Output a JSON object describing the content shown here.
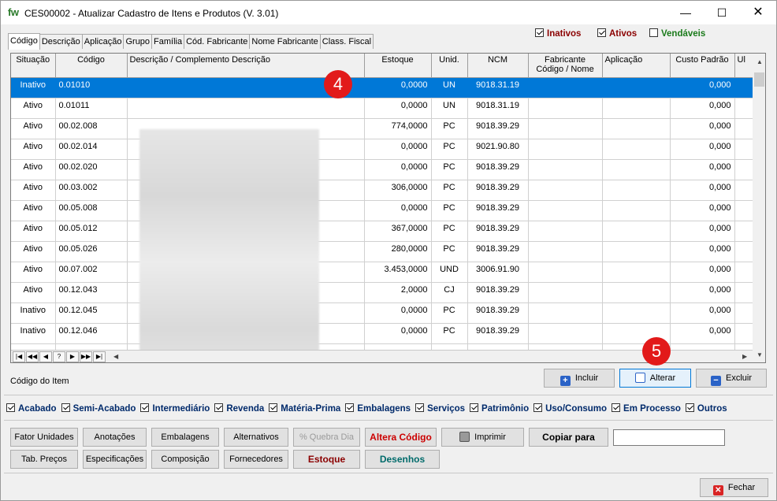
{
  "window": {
    "icon_text": "fw",
    "title": "CES00002 - Atualizar Cadastro de Itens e Produtos  (V. 3.01)",
    "min_glyph": "—",
    "max_glyph": "☐",
    "close_glyph": "✕"
  },
  "tabs": [
    "Código",
    "Descrição",
    "Aplicação",
    "Grupo",
    "Família",
    "Cód. Fabricante",
    "Nome Fabricante",
    "Class. Fiscal"
  ],
  "filters_top": [
    {
      "label": "Inativos",
      "checked": true,
      "color": "#8b0000"
    },
    {
      "label": "Ativos",
      "checked": true,
      "color": "#8b0000"
    },
    {
      "label": "Vendáveis",
      "checked": false,
      "color": "#1a7a1a"
    }
  ],
  "grid": {
    "columns": [
      "Situação",
      "Código",
      "Descrição / Complemento Descrição",
      "Estoque",
      "Unid.",
      "NCM",
      "Fabricante Código / Nome",
      "Aplicação",
      "Custo Padrão",
      "Ul"
    ],
    "rows": [
      [
        "Inativo",
        "0.01010",
        "0,0000",
        "UN",
        "9018.31.19",
        "0,000"
      ],
      [
        "Ativo",
        "0.01011",
        "0,0000",
        "UN",
        "9018.31.19",
        "0,000"
      ],
      [
        "Ativo",
        "00.02.008",
        "774,0000",
        "PC",
        "9018.39.29",
        "0,000"
      ],
      [
        "Ativo",
        "00.02.014",
        "0,0000",
        "PC",
        "9021.90.80",
        "0,000"
      ],
      [
        "Ativo",
        "00.02.020",
        "0,0000",
        "PC",
        "9018.39.29",
        "0,000"
      ],
      [
        "Ativo",
        "00.03.002",
        "306,0000",
        "PC",
        "9018.39.29",
        "0,000"
      ],
      [
        "Ativo",
        "00.05.008",
        "0,0000",
        "PC",
        "9018.39.29",
        "0,000"
      ],
      [
        "Ativo",
        "00.05.012",
        "367,0000",
        "PC",
        "9018.39.29",
        "0,000"
      ],
      [
        "Ativo",
        "00.05.026",
        "280,0000",
        "PC",
        "9018.39.29",
        "0,000"
      ],
      [
        "Ativo",
        "00.07.002",
        "3.453,0000",
        "UND",
        "3006.91.90",
        "0,000"
      ],
      [
        "Ativo",
        "00.12.043",
        "2,0000",
        "CJ",
        "9018.39.29",
        "0,000"
      ],
      [
        "Inativo",
        "00.12.045",
        "0,0000",
        "PC",
        "9018.39.29",
        "0,000"
      ],
      [
        "Inativo",
        "00.12.046",
        "0,0000",
        "PC",
        "9018.39.29",
        "0,000"
      ]
    ],
    "nav_buttons": [
      "|◀",
      "◀◀",
      "◀",
      "?",
      "▶",
      "▶▶",
      "▶|"
    ]
  },
  "badges": {
    "step4": "4",
    "step5": "5"
  },
  "status_label": "Código do Item",
  "actions": {
    "incluir": "Incluir",
    "alterar": "Alterar",
    "excluir": "Excluir"
  },
  "filters_bottom": [
    "Acabado",
    "Semi-Acabado",
    "Intermediário",
    "Revenda",
    "Matéria-Prima",
    "Embalagens",
    "Serviços",
    "Patrimônio",
    "Uso/Consumo",
    "Em Processo",
    "Outros"
  ],
  "tools": {
    "fator_unidades": "Fator Unidades",
    "anotacoes": "Anotações",
    "embalagens": "Embalagens",
    "alternativos": "Alternativos",
    "quebra_dia": "% Quebra Dia",
    "altera_codigo": "Altera Código",
    "imprimir": "Imprimir",
    "copiar_para": "Copiar para",
    "tab_precos": "Tab. Preços",
    "especificacoes": "Especificações",
    "composicao": "Composição",
    "fornecedores": "Fornecedores",
    "estoque": "Estoque",
    "desenhos": "Desenhos"
  },
  "copiar_value": "",
  "fechar": "Fechar",
  "colors": {
    "selection": "#0078d7",
    "badge": "#e21a1a",
    "altera": "#cc0000",
    "estoque": "#8b0000",
    "desenhos": "#006b6b"
  }
}
